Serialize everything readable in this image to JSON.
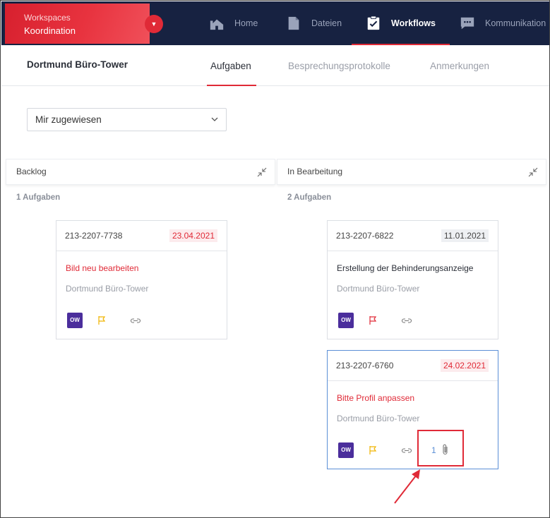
{
  "workspace": {
    "label": "Workspaces",
    "name": "Koordination"
  },
  "nav": [
    {
      "label": "Home",
      "icon": "home-icon"
    },
    {
      "label": "Dateien",
      "icon": "file-icon"
    },
    {
      "label": "Workflows",
      "icon": "clipboard-check-icon",
      "active": true
    },
    {
      "label": "Kommunikation",
      "icon": "chat-icon"
    }
  ],
  "project": {
    "title": "Dortmund Büro-Tower"
  },
  "tabs": [
    {
      "label": "Aufgaben",
      "active": true
    },
    {
      "label": "Besprechungsprotokolle"
    },
    {
      "label": "Anmerkungen"
    }
  ],
  "filter": {
    "selected": "Mir zugewiesen"
  },
  "columns": [
    {
      "title": "Backlog",
      "count_label": "1 Aufgaben",
      "cards": [
        {
          "id": "213-2207-7738",
          "date": "23.04.2021",
          "date_style": "red",
          "title": "Bild neu bearbeiten",
          "title_style": "red",
          "project": "Dortmund Büro-Tower",
          "avatar": "OW",
          "flag_color": "#f0b400"
        }
      ]
    },
    {
      "title": "In Bearbeitung",
      "count_label": "2 Aufgaben",
      "cards": [
        {
          "id": "213-2207-6822",
          "date": "11.01.2021",
          "date_style": "grey",
          "title": "Erstellung der Behinderungsanzeige",
          "title_style": "dark",
          "project": "Dortmund Büro-Tower",
          "avatar": "OW",
          "flag_color": "#e02a37"
        },
        {
          "id": "213-2207-6760",
          "date": "24.02.2021",
          "date_style": "red",
          "title": "Bitte Profil anpassen",
          "title_style": "red",
          "project": "Dortmund Büro-Tower",
          "avatar": "OW",
          "flag_color": "#f0b400",
          "attachments": "1"
        }
      ]
    }
  ],
  "colors": {
    "brand_red": "#e02a37",
    "nav_bg": "#172241",
    "avatar_purple": "#4b2e9c",
    "link_blue": "#5b8fd6"
  }
}
